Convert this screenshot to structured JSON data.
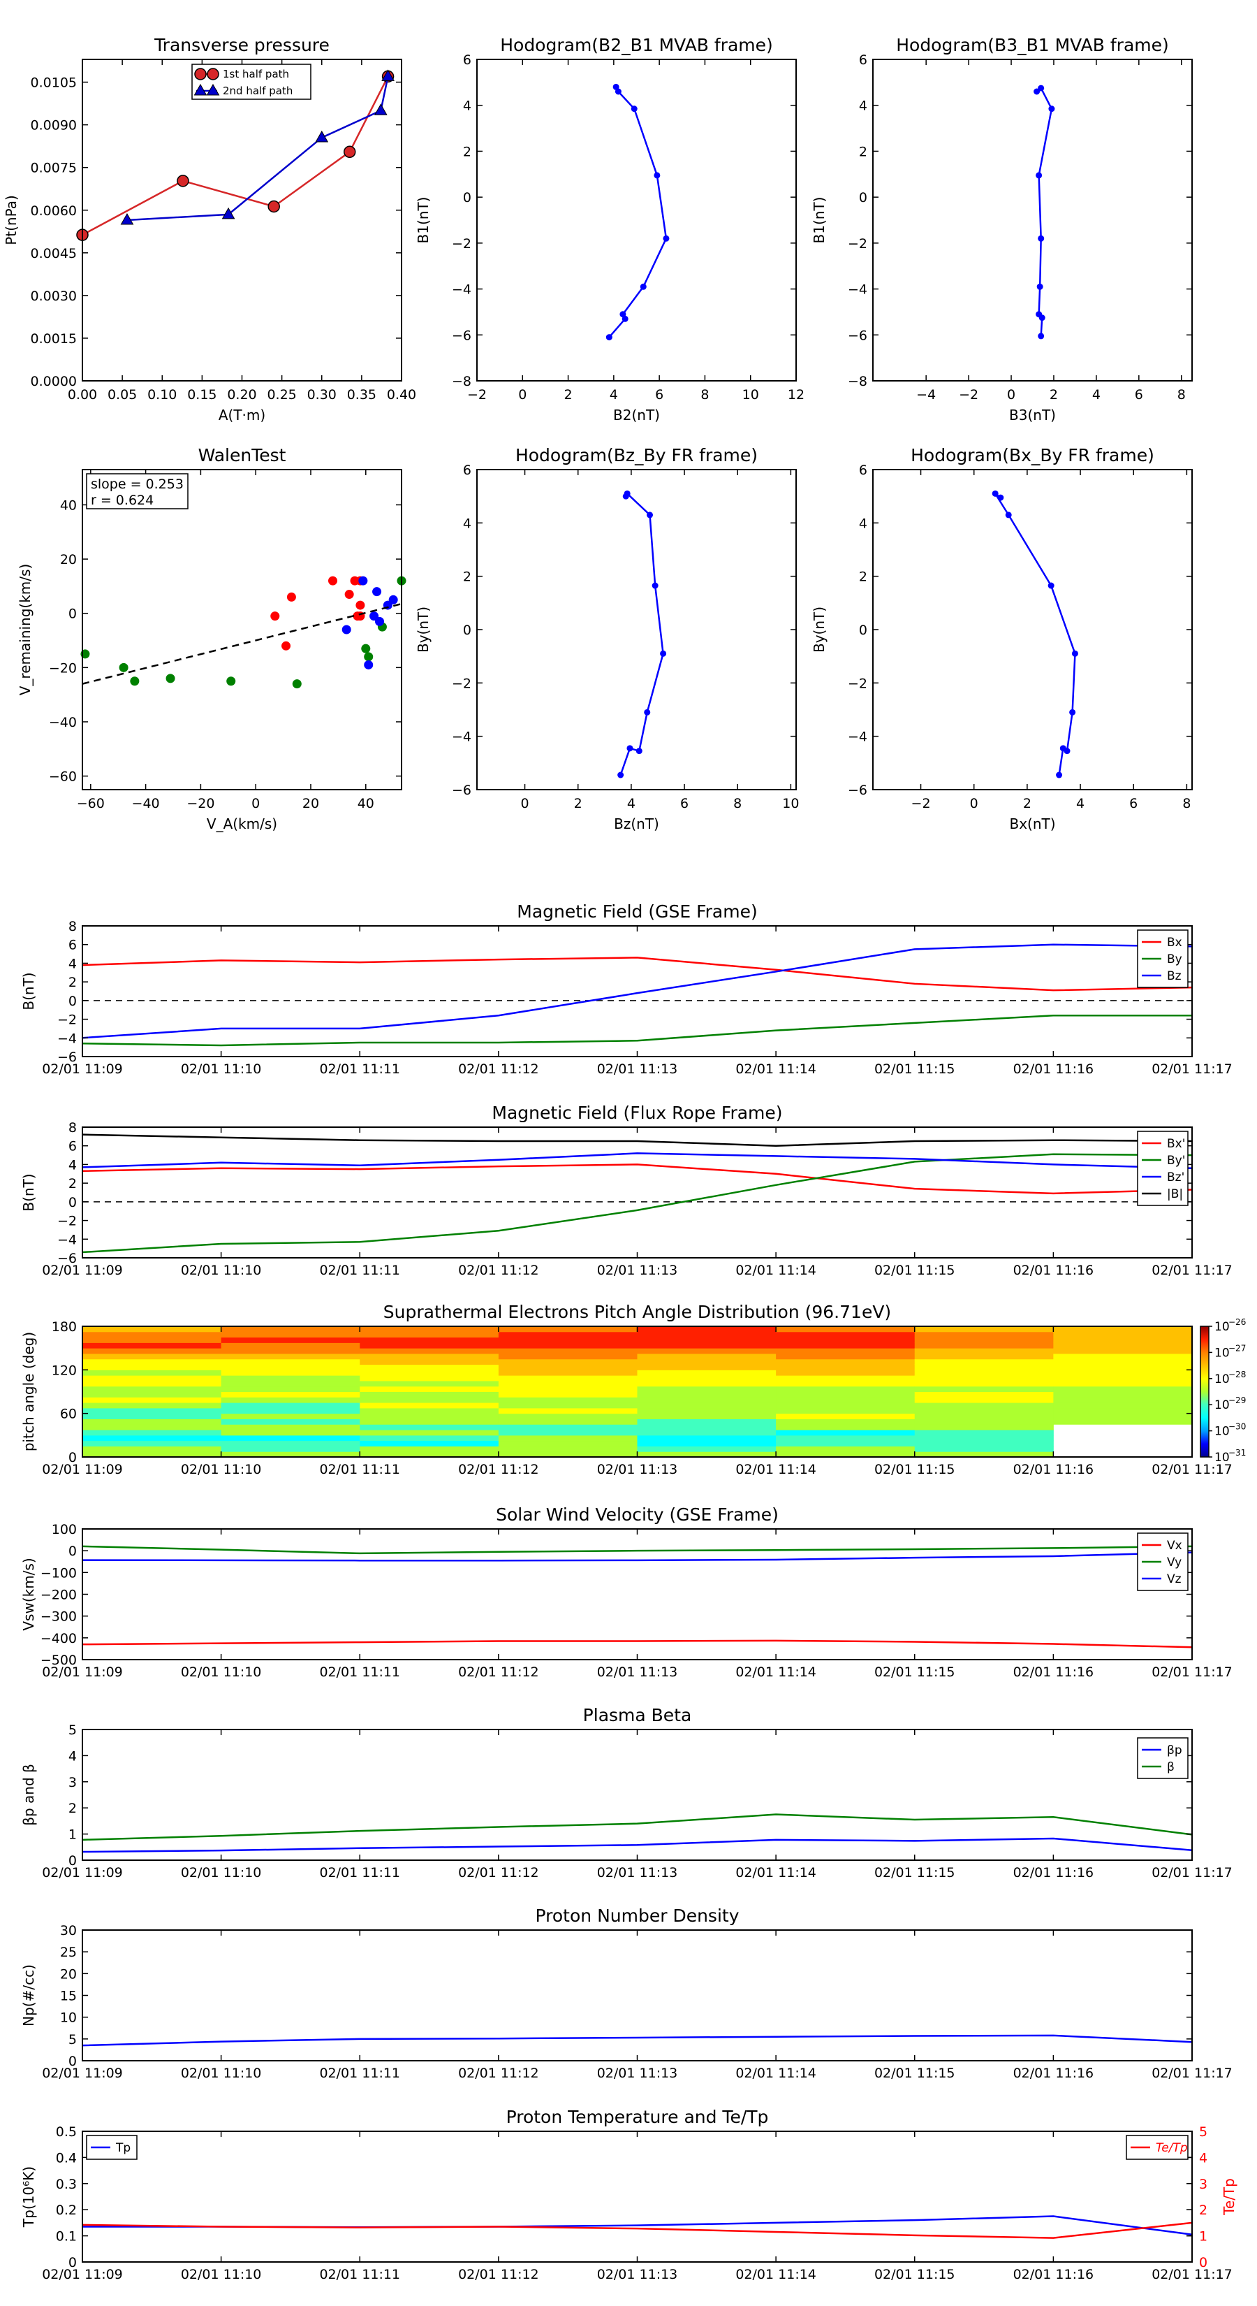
{
  "chart_data": [
    {
      "id": "pt",
      "type": "line",
      "title": "Transverse pressure",
      "xlabel": "A(T·m)",
      "ylabel": "Pt(nPa)",
      "xlim": [
        0,
        0.4
      ],
      "ylim": [
        0,
        0.0113
      ],
      "xticks": [
        0,
        0.05,
        0.1,
        0.15,
        0.2,
        0.25,
        0.3,
        0.35,
        0.4
      ],
      "xticklabels": [
        "0.00",
        "0.05",
        "0.10",
        "0.15",
        "0.20",
        "0.25",
        "0.30",
        "0.35",
        "0.40"
      ],
      "yticks": [
        0,
        0.0015,
        0.003,
        0.0045,
        0.006,
        0.0075,
        0.009,
        0.0105
      ],
      "yticklabels": [
        "0.0000",
        "0.0015",
        "0.0030",
        "0.0045",
        "0.0060",
        "0.0075",
        "0.0090",
        "0.0105"
      ],
      "legend": "top-center",
      "series": [
        {
          "name": "1st half path",
          "color": "#d62728",
          "marker": "circle",
          "x": [
            0.0,
            0.126,
            0.24,
            0.335,
            0.383
          ],
          "y": [
            0.00513,
            0.00703,
            0.00613,
            0.00805,
            0.0107
          ]
        },
        {
          "name": "2nd half path",
          "color": "#0000cc",
          "marker": "triangle",
          "x": [
            0.056,
            0.183,
            0.3,
            0.374,
            0.383
          ],
          "y": [
            0.00565,
            0.00585,
            0.00855,
            0.0095,
            0.0107
          ]
        }
      ]
    },
    {
      "id": "h1",
      "type": "line",
      "title": "Hodogram(B2_B1 MVAB frame)",
      "xlabel": "B2(nT)",
      "ylabel": "B1(nT)",
      "xlim": [
        -2,
        12
      ],
      "ylim": [
        -8,
        6
      ],
      "xticks": [
        -2,
        0,
        2,
        4,
        6,
        8,
        10,
        12
      ],
      "yticks": [
        -8,
        -6,
        -4,
        -2,
        0,
        2,
        4,
        6
      ],
      "series": [
        {
          "name": "",
          "color": "#0000ff",
          "marker": "dot",
          "x": [
            4.1,
            4.2,
            4.9,
            5.9,
            6.3,
            5.3,
            4.4,
            4.5,
            3.8
          ],
          "y": [
            4.8,
            4.6,
            3.85,
            0.95,
            -1.8,
            -3.9,
            -5.1,
            -5.3,
            -6.1
          ]
        }
      ]
    },
    {
      "id": "h2",
      "type": "line",
      "title": "Hodogram(B3_B1 MVAB frame)",
      "xlabel": "B3(nT)",
      "ylabel": "B1(nT)",
      "xlim": [
        -6.5,
        8.5
      ],
      "ylim": [
        -8,
        6
      ],
      "xticks": [
        -4,
        -2,
        0,
        2,
        4,
        6,
        8
      ],
      "yticks": [
        -8,
        -6,
        -4,
        -2,
        0,
        2,
        4,
        6
      ],
      "series": [
        {
          "name": "",
          "color": "#0000ff",
          "marker": "dot",
          "x": [
            1.2,
            1.4,
            1.9,
            1.3,
            1.4,
            1.35,
            1.3,
            1.45,
            1.4
          ],
          "y": [
            4.6,
            4.75,
            3.85,
            0.95,
            -1.8,
            -3.9,
            -5.1,
            -5.25,
            -6.05
          ]
        }
      ]
    },
    {
      "id": "walen",
      "type": "scatter",
      "title": "WalenTest",
      "xlabel": "V_A(km/s)",
      "ylabel": "V_remaining(km/s)",
      "xlim": [
        -63,
        53
      ],
      "ylim": [
        -65,
        53
      ],
      "xticks": [
        -60,
        -40,
        -20,
        0,
        20,
        40
      ],
      "yticks": [
        -60,
        -40,
        -20,
        0,
        20,
        40
      ],
      "annotations": [
        "slope = 0.253",
        "r = 0.624"
      ],
      "fit": {
        "color": "#000000",
        "style": "dashed",
        "x": [
          -63,
          53
        ],
        "y": [
          -26,
          3.5
        ]
      },
      "series": [
        {
          "name": "",
          "color": "#ff0000",
          "x": [
            7,
            11,
            13,
            28,
            34,
            36,
            38,
            38,
            37,
            38
          ],
          "y": [
            -1,
            -12,
            6,
            12,
            7,
            12,
            12,
            3,
            -1,
            -1
          ]
        },
        {
          "name": "",
          "color": "#008000",
          "x": [
            -62,
            -48,
            -44,
            -31,
            -9,
            15,
            40,
            41,
            46,
            53
          ],
          "y": [
            -15,
            -20,
            -25,
            -24,
            -25,
            -26,
            -13,
            -16,
            -5,
            12
          ]
        },
        {
          "name": "",
          "color": "#0000ff",
          "x": [
            33,
            39,
            41,
            43,
            44,
            45,
            48,
            50
          ],
          "y": [
            -6,
            12,
            -19,
            -1,
            8,
            -3,
            3,
            5
          ]
        }
      ]
    },
    {
      "id": "h3",
      "type": "line",
      "title": "Hodogram(Bz_By FR frame)",
      "xlabel": "Bz(nT)",
      "ylabel": "By(nT)",
      "xlim": [
        -1.8,
        10.2
      ],
      "ylim": [
        -6,
        6
      ],
      "xticks": [
        0,
        2,
        4,
        6,
        8,
        10
      ],
      "yticks": [
        -6,
        -4,
        -2,
        0,
        2,
        4,
        6
      ],
      "series": [
        {
          "name": "",
          "color": "#0000ff",
          "marker": "dot",
          "x": [
            3.8,
            3.85,
            4.7,
            4.9,
            5.2,
            4.6,
            4.3,
            3.95,
            3.6
          ],
          "y": [
            5.0,
            5.1,
            4.3,
            1.65,
            -0.9,
            -3.1,
            -4.55,
            -4.45,
            -5.45
          ]
        }
      ]
    },
    {
      "id": "h4",
      "type": "line",
      "title": "Hodogram(Bx_By FR frame)",
      "xlabel": "Bx(nT)",
      "ylabel": "By(nT)",
      "xlim": [
        -3.8,
        8.2
      ],
      "ylim": [
        -6,
        6
      ],
      "xticks": [
        -2,
        0,
        2,
        4,
        6,
        8
      ],
      "yticks": [
        -6,
        -4,
        -2,
        0,
        2,
        4,
        6
      ],
      "series": [
        {
          "name": "",
          "color": "#0000ff",
          "marker": "dot",
          "x": [
            1.0,
            0.8,
            1.3,
            2.9,
            3.8,
            3.7,
            3.5,
            3.35,
            3.2
          ],
          "y": [
            4.95,
            5.1,
            4.3,
            1.65,
            -0.9,
            -3.1,
            -4.55,
            -4.45,
            -5.45
          ]
        }
      ]
    },
    {
      "id": "bgse",
      "type": "line",
      "title": "Magnetic Field (GSE Frame)",
      "ylabel": "B(nT)",
      "ylim": [
        -6,
        8
      ],
      "yticks": [
        -6,
        -4,
        -2,
        0,
        2,
        4,
        6,
        8
      ],
      "zero_line": true,
      "legend": "top-right",
      "series": [
        {
          "name": "Bx",
          "color": "#ff0000",
          "values": [
            3.8,
            4.3,
            4.1,
            4.4,
            4.6,
            3.3,
            1.8,
            1.1,
            1.4
          ]
        },
        {
          "name": "By",
          "color": "#008000",
          "values": [
            -4.6,
            -4.8,
            -4.5,
            -4.5,
            -4.3,
            -3.2,
            -2.4,
            -1.6,
            -1.6
          ]
        },
        {
          "name": "Bz",
          "color": "#0000ff",
          "values": [
            -4.0,
            -3.0,
            -3.0,
            -1.6,
            0.8,
            3.1,
            5.5,
            6.0,
            5.8
          ]
        }
      ]
    },
    {
      "id": "bfr",
      "type": "line",
      "title": "Magnetic Field (Flux Rope Frame)",
      "ylabel": "B(nT)",
      "ylim": [
        -6,
        8
      ],
      "yticks": [
        -6,
        -4,
        -2,
        0,
        2,
        4,
        6,
        8
      ],
      "zero_line": true,
      "legend": "top-right",
      "series": [
        {
          "name": "Bx'",
          "color": "#ff0000",
          "values": [
            3.3,
            3.6,
            3.5,
            3.8,
            4.0,
            3.0,
            1.4,
            0.9,
            1.3
          ]
        },
        {
          "name": "By'",
          "color": "#008000",
          "values": [
            -5.4,
            -4.5,
            -4.3,
            -3.1,
            -0.9,
            1.8,
            4.3,
            5.1,
            5.0
          ]
        },
        {
          "name": "Bz'",
          "color": "#0000ff",
          "values": [
            3.7,
            4.2,
            3.9,
            4.5,
            5.2,
            4.9,
            4.6,
            4.0,
            3.6
          ]
        },
        {
          "name": "|B|",
          "color": "#000000",
          "values": [
            7.2,
            6.9,
            6.6,
            6.5,
            6.5,
            6.0,
            6.5,
            6.6,
            6.5
          ]
        }
      ]
    },
    {
      "id": "pad",
      "type": "heatmap",
      "title": "Suprathermal Electrons Pitch Angle Distribution (96.71eV)",
      "ylabel": "pitch angle (deg)",
      "ylim": [
        0,
        180
      ],
      "yticks": [
        0,
        60,
        120,
        180
      ],
      "colorbar": {
        "exponents": [
          -26,
          -27,
          -28,
          -29,
          -30,
          -31
        ],
        "base": "10"
      }
    },
    {
      "id": "vsw",
      "type": "line",
      "title": "Solar Wind Velocity (GSE Frame)",
      "ylabel": "Vsw(km/s)",
      "ylim": [
        -500,
        100
      ],
      "yticks": [
        -500,
        -400,
        -300,
        -200,
        -100,
        0,
        100
      ],
      "legend": "top-right",
      "series": [
        {
          "name": "Vx",
          "color": "#ff0000",
          "values": [
            -430,
            -425,
            -420,
            -415,
            -415,
            -413,
            -418,
            -428,
            -443
          ]
        },
        {
          "name": "Vy",
          "color": "#008000",
          "values": [
            20,
            5,
            -12,
            -5,
            0,
            3,
            7,
            12,
            20
          ]
        },
        {
          "name": "Vz",
          "color": "#0000ff",
          "values": [
            -43,
            -44,
            -45,
            -45,
            -44,
            -41,
            -32,
            -25,
            -8
          ]
        }
      ]
    },
    {
      "id": "beta",
      "type": "line",
      "title": "Plasma Beta",
      "ylabel": "βp and β",
      "ylim": [
        0,
        5
      ],
      "yticks": [
        0,
        1,
        2,
        3,
        4,
        5
      ],
      "legend": "top-right",
      "series": [
        {
          "name": "βp",
          "color": "#0000ff",
          "values": [
            0.32,
            0.37,
            0.46,
            0.52,
            0.58,
            0.78,
            0.74,
            0.83,
            0.38
          ]
        },
        {
          "name": "β",
          "color": "#008000",
          "values": [
            0.78,
            0.93,
            1.12,
            1.27,
            1.4,
            1.75,
            1.55,
            1.65,
            0.98
          ]
        }
      ]
    },
    {
      "id": "np",
      "type": "line",
      "title": "Proton Number Density",
      "ylabel": "Np(#/cc)",
      "ylim": [
        0,
        30
      ],
      "yticks": [
        0,
        5,
        10,
        15,
        20,
        25,
        30
      ],
      "series": [
        {
          "name": "",
          "color": "#0000ff",
          "values": [
            3.5,
            4.4,
            5.0,
            5.1,
            5.3,
            5.5,
            5.7,
            5.8,
            4.3
          ]
        }
      ]
    },
    {
      "id": "tp",
      "type": "line",
      "title": "Proton Temperature and Te/Tp",
      "ylabel": "Tp(10⁶K)",
      "ylabel_right": "Te/Tp",
      "ylim": [
        0,
        0.5
      ],
      "yticks": [
        0,
        0.1,
        0.2,
        0.3,
        0.4,
        0.5
      ],
      "ylim_right": [
        0,
        5
      ],
      "yticks_right": [
        0,
        1,
        2,
        3,
        4,
        5
      ],
      "series": [
        {
          "name": "Tp",
          "color": "#0000ff",
          "axis": "left",
          "values": [
            0.135,
            0.135,
            0.133,
            0.135,
            0.14,
            0.15,
            0.16,
            0.175,
            0.105
          ]
        },
        {
          "name": "Te/Tp",
          "color": "#ff0000",
          "axis": "right",
          "values": [
            1.42,
            1.35,
            1.32,
            1.35,
            1.28,
            1.15,
            1.02,
            0.92,
            1.5
          ]
        }
      ]
    }
  ],
  "time_axis": {
    "ticklabels": [
      "02/01 11:09",
      "02/01 11:10",
      "02/01 11:11",
      "02/01 11:12",
      "02/01 11:13",
      "02/01 11:14",
      "02/01 11:15",
      "02/01 11:16",
      "02/01 11:17"
    ]
  },
  "colors": {
    "frame": "#000000",
    "background": "#ffffff"
  }
}
